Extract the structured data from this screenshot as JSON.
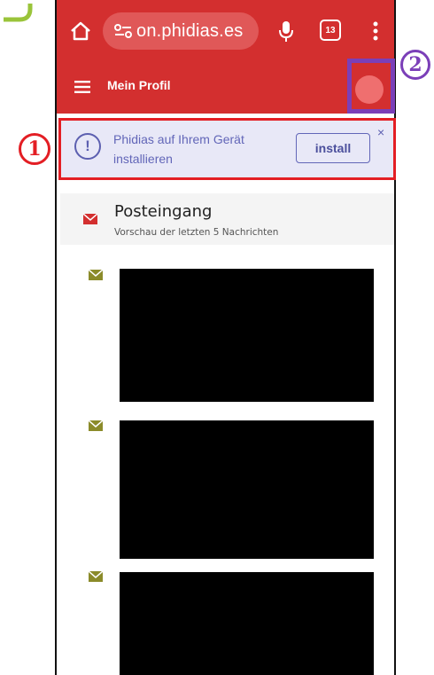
{
  "browser": {
    "url": "on.phidias.es",
    "tab_count": "13"
  },
  "app_bar": {
    "title": "Mein Profil"
  },
  "install_banner": {
    "message": "Phidias auf Ihrem Gerät installieren",
    "button_label": "install",
    "close_label": "×"
  },
  "inbox": {
    "title": "Posteingang",
    "subtitle": "Vorschau der letzten 5 Nachrichten"
  },
  "annotations": {
    "one": "1",
    "two": "2"
  },
  "colors": {
    "brand_red": "#d32f2f",
    "banner_bg": "#e8e8f7",
    "banner_text": "#6266b8",
    "annotation_red": "#e31e24",
    "annotation_purple": "#7b3fb8",
    "message_icon": "#8b8b2a"
  }
}
